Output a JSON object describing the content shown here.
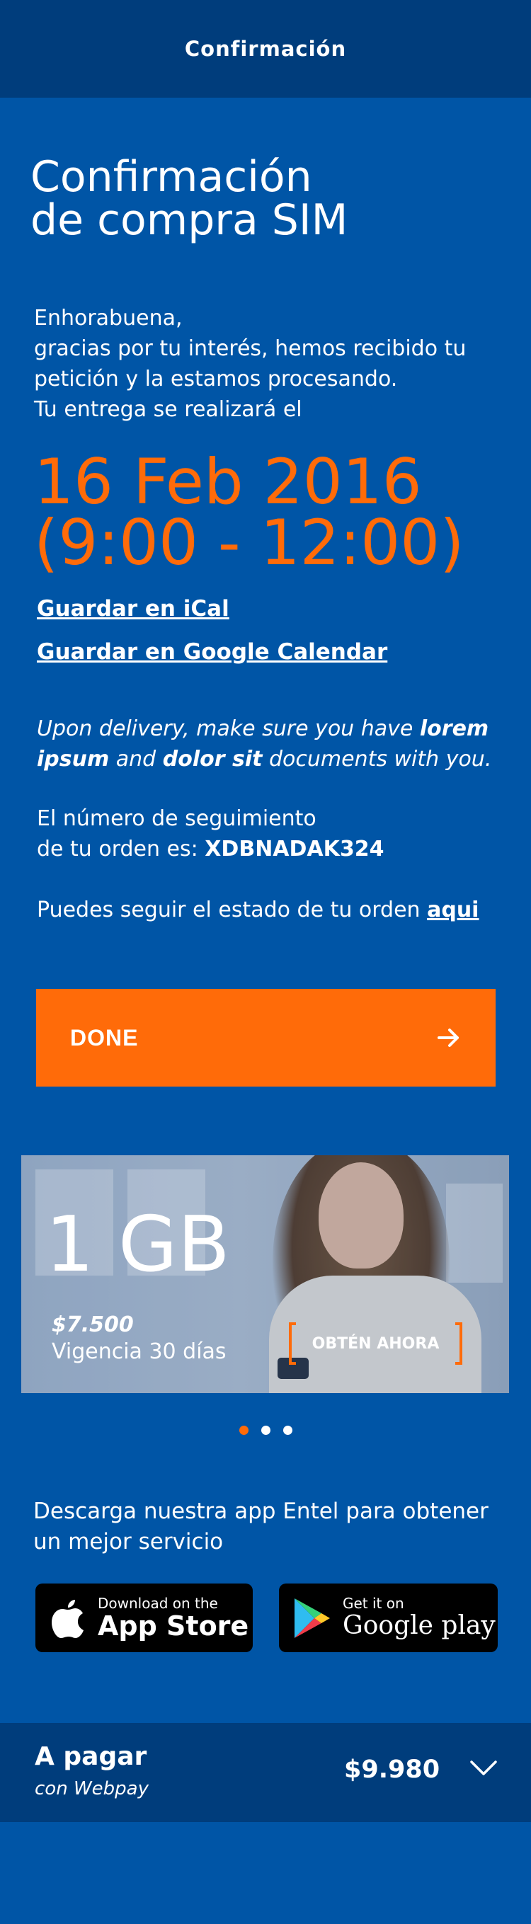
{
  "header": {
    "title": "Confirmación"
  },
  "main": {
    "title_line1": "Confirmación",
    "title_line2": "de compra SIM",
    "intro_line1": "Enhorabuena,",
    "intro_line2": "gracias por tu interés, hemos recibido tu",
    "intro_line3": "petición y la estamos procesando.",
    "intro_line4": "Tu entrega se realizará el",
    "delivery_date": "16 Feb 2016",
    "delivery_time": "(9:00 - 12:00)",
    "ical_link": "Guardar en iCal",
    "google_link": "Guardar en Google Calendar",
    "delivery_note": {
      "part1": "Upon delivery, make sure you have ",
      "bold1": "lorem ipsum",
      "part2": " and ",
      "bold2": "dolor sit",
      "part3": " documents with you."
    },
    "tracking_line1": "El número de seguimiento",
    "tracking_line2": "de tu orden es: ",
    "tracking_code": "XDBNADAK324",
    "follow_text": "Puedes seguir el estado de tu orden ",
    "follow_link": "aqui"
  },
  "done_button": {
    "label": "DONE",
    "icon": "arrow-right-icon"
  },
  "promo": {
    "amount": "1 GB",
    "price": "$7.500",
    "validity": "Vigencia 30 días",
    "cta": "OBTÉN AHORA",
    "slides_total": 3,
    "active_slide": 1
  },
  "apps": {
    "text": "Descarga nuestra app Entel para obtener un mejor servicio",
    "appstore_small": "Download on the",
    "appstore_big": "App Store",
    "gplay_small": "Get it on",
    "gplay_big": "Google play"
  },
  "payment": {
    "label": "A pagar",
    "method": "con Webpay",
    "amount": "$9.980",
    "icon": "chevron-down-icon"
  },
  "colors": {
    "accent": "#ff6b09",
    "background": "#0055a6",
    "bar": "#003d7c"
  }
}
